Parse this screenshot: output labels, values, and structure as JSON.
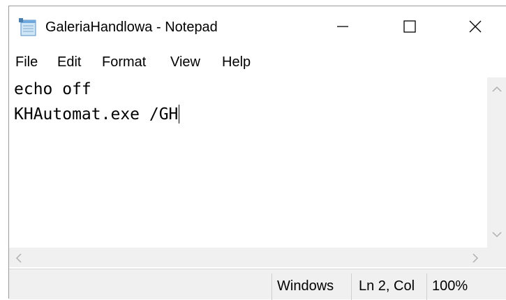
{
  "window": {
    "title": "GaleriaHandlowa - Notepad",
    "app_icon": "notepad-icon"
  },
  "caption_buttons": {
    "minimize_icon": "minimize-icon",
    "maximize_icon": "maximize-icon",
    "close_icon": "close-icon"
  },
  "menu": {
    "items": [
      {
        "label": "File"
      },
      {
        "label": "Edit"
      },
      {
        "label": "Format"
      },
      {
        "label": "View"
      },
      {
        "label": "Help"
      }
    ]
  },
  "editor": {
    "lines": [
      "echo off",
      "KHAutomat.exe /GH"
    ]
  },
  "status": {
    "line_ending": "Windows",
    "position": "Ln 2, Col",
    "zoom": "100%"
  },
  "colors": {
    "chrome_gray": "#f0f0f0",
    "text": "#000000",
    "background": "#ffffff"
  }
}
